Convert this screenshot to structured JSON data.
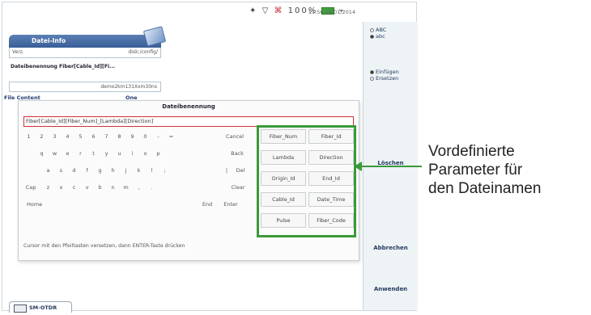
{
  "statusbar": {
    "battery_pct": "100%",
    "time": "11:56  28/01/2014"
  },
  "sidepanel": {
    "case_options": [
      "ABC",
      "abc"
    ],
    "case_selected": 1,
    "insert_options": [
      "Einfügen",
      "Ersetzen"
    ],
    "insert_selected": 0,
    "delete_label": "Löschen",
    "cancel_label": "Abbrechen",
    "apply_label": "Anwenden"
  },
  "file_info": {
    "title": "Datei-Info",
    "dir_label": "Verz.",
    "dir_value": "disk:/config/",
    "naming_label": "Dateibenennung  Fiber[Cable_Id][Fi...",
    "naming_example": "demo2km131Xxm30ns",
    "content_label": "File Content",
    "content_value": "One Trace"
  },
  "dialog": {
    "title": "Dateibenennung",
    "input_value": "Fiber[Cable_Id][Fiber_Num]_[Lambda][Direction]",
    "keyboard": {
      "row1": [
        "1",
        "2",
        "3",
        "4",
        "5",
        "6",
        "7",
        "8",
        "9",
        "0",
        "-",
        "="
      ],
      "row1_action": "Cancel",
      "row2": [
        "q",
        "w",
        "e",
        "r",
        "t",
        "y",
        "u",
        "i",
        "o",
        "p"
      ],
      "row2_action": "Back",
      "row3": [
        "a",
        "s",
        "d",
        "f",
        "g",
        "h",
        "j",
        "k",
        "l",
        ";"
      ],
      "row3_pipe": "|",
      "row3_action": "Del",
      "row4_cap": "Cap",
      "row4": [
        "z",
        "x",
        "c",
        "v",
        "b",
        "n",
        "m",
        ",",
        "."
      ],
      "row4_action": "Clear",
      "home_label": "Home",
      "end_label": "End",
      "enter_label": "Enter"
    },
    "params": [
      "Fiber_Num",
      "Fiber_Id",
      "Lambda",
      "Direction",
      "Origin_Id",
      "End_Id",
      "Cable_Id",
      "Date_Time",
      "Pulse",
      "Fiber_Code"
    ],
    "hint": "Cursor mit den Pfeiltasten versetzen, dann ENTER-Taste drücken"
  },
  "tab": {
    "label": "SM-OTDR"
  },
  "callout": {
    "lines": [
      "Vordefinierte",
      "Parameter für",
      "den Dateinamen"
    ],
    "color": "#3a9a3a"
  }
}
